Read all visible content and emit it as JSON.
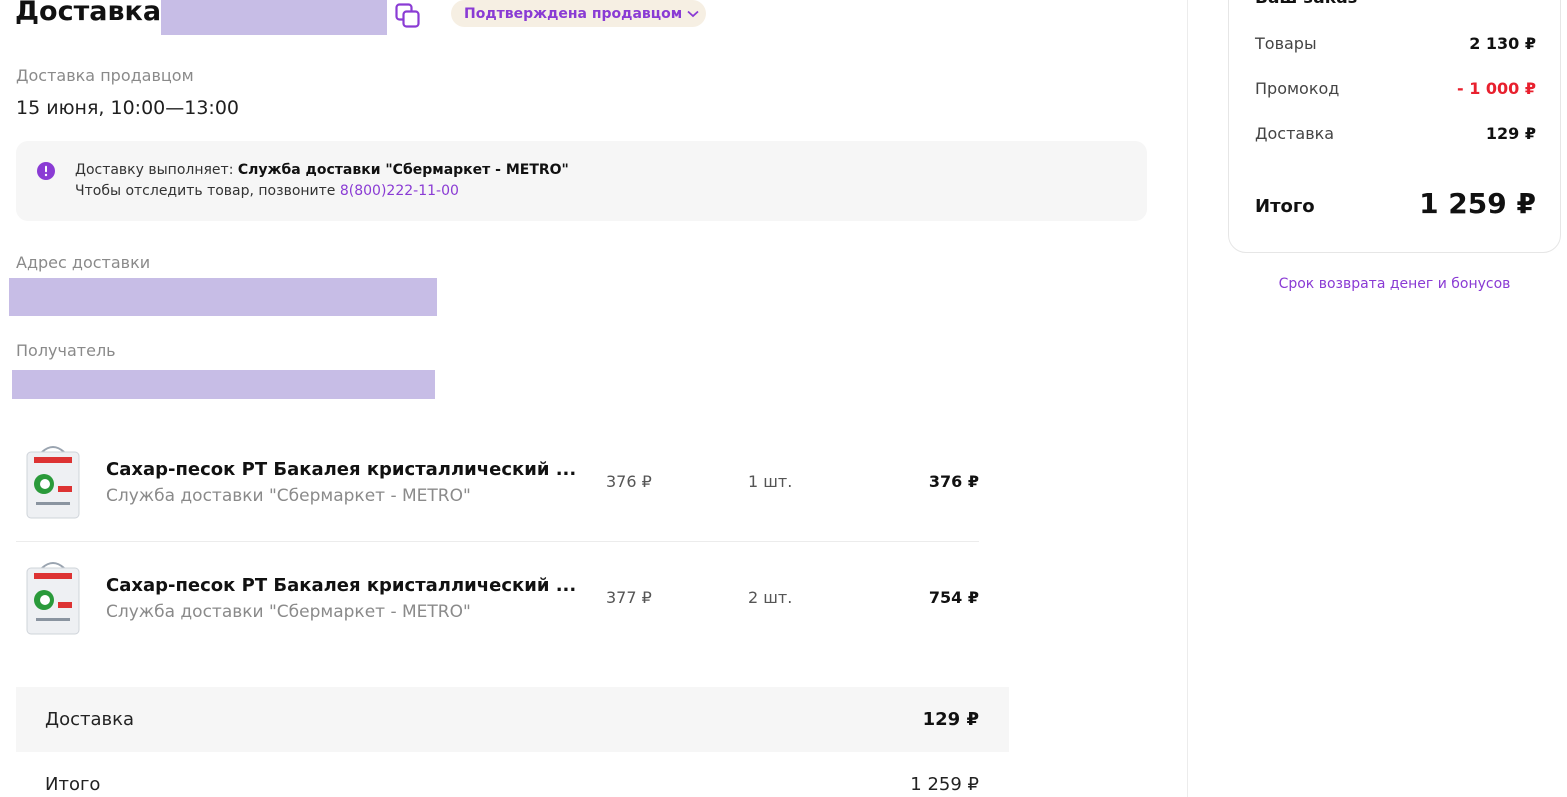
{
  "header": {
    "title": "Доставка",
    "status": "Подтверждена продавцом"
  },
  "delivery": {
    "method_label": "Доставка продавцом",
    "date": "15 июня, 10:00—13:00",
    "info_prefix": "Доставку выполняет:",
    "info_service": "Служба доставки \"Сбермаркет - METRO\"",
    "info_track_prefix": "Чтобы отследить товар, позвоните",
    "info_phone": "8(800)222-11-00",
    "address_label": "Адрес доставки",
    "recipient_label": "Получатель"
  },
  "items": [
    {
      "name": "Сахар-песок РТ Бакалея кристаллический ...",
      "seller": "Служба доставки \"Сбермаркет - METRO\"",
      "price": "376 ₽",
      "qty": "1 шт.",
      "total": "376 ₽"
    },
    {
      "name": "Сахар-песок РТ Бакалея кристаллический ...",
      "seller": "Служба доставки \"Сбермаркет - METRO\"",
      "price": "377 ₽",
      "qty": "2 шт.",
      "total": "754 ₽"
    }
  ],
  "summary": {
    "delivery_label": "Доставка",
    "delivery_value": "129 ₽",
    "total_label": "Итого",
    "total_value": "1 259 ₽"
  },
  "order": {
    "header": "Ваш заказ",
    "goods_label": "Товары",
    "goods_value": "2 130 ₽",
    "promo_label": "Промокод",
    "promo_value": "- 1 000 ₽",
    "delivery_label": "Доставка",
    "delivery_value": "129 ₽",
    "total_label": "Итого",
    "total_value": "1 259 ₽",
    "refund_link": "Срок возврата денег и бонусов"
  },
  "colors": {
    "accent": "#8a3bd4",
    "promo": "#e8202e",
    "redaction": "#c7bde6"
  }
}
